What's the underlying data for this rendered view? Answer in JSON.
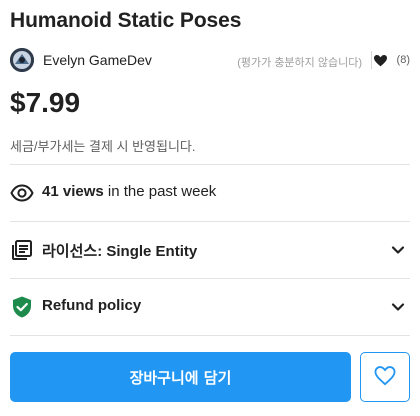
{
  "product": {
    "title": "Humanoid Static Poses",
    "price": "$7.99",
    "tax_note": "세금/부가세는 결제 시 반영됩니다."
  },
  "publisher": {
    "name": "Evelyn GameDev",
    "avatar_icon": "publisher-avatar"
  },
  "rating": {
    "text": "(평가가 충분하지 않습니다)",
    "favorites": "(8)",
    "favorite_icon": "heart-icon"
  },
  "views": {
    "icon": "eye-icon",
    "count": "41 views",
    "suffix": " in the past week"
  },
  "license": {
    "icon": "license-document-icon",
    "label": "라이선스: Single Entity"
  },
  "refund": {
    "icon": "shield-check-icon",
    "label": "Refund policy"
  },
  "actions": {
    "add_to_cart": "장바구니에 담기",
    "wishlist_icon": "heart-outline-icon"
  },
  "colors": {
    "accent": "#2196f3",
    "refund_shield": "#1e8a4c"
  }
}
